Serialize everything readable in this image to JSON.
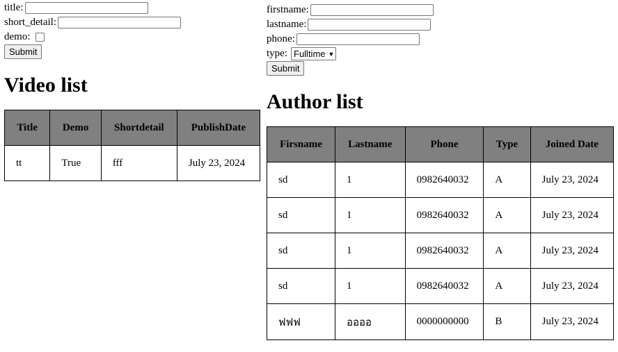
{
  "video_form": {
    "title_label": "title:",
    "short_detail_label": "short_detail:",
    "demo_label": "demo:",
    "submit_label": "Submit"
  },
  "video_list": {
    "heading": "Video list",
    "columns": [
      "Title",
      "Demo",
      "Shortdetail",
      "PublishDate"
    ],
    "rows": [
      [
        "tt",
        "True",
        "fff",
        "July 23, 2024"
      ]
    ]
  },
  "author_form": {
    "firstname_label": "firstname:",
    "lastname_label": "lastname:",
    "phone_label": "phone:",
    "type_label": "type:",
    "type_selected": "Fulltime",
    "submit_label": "Submit"
  },
  "author_list": {
    "heading": "Author list",
    "columns": [
      "Firsname",
      "Lastname",
      "Phone",
      "Type",
      "Joined Date"
    ],
    "rows": [
      [
        "sd",
        "1",
        "0982640032",
        "A",
        "July 23, 2024"
      ],
      [
        "sd",
        "1",
        "0982640032",
        "A",
        "July 23, 2024"
      ],
      [
        "sd",
        "1",
        "0982640032",
        "A",
        "July 23, 2024"
      ],
      [
        "sd",
        "1",
        "0982640032",
        "A",
        "July 23, 2024"
      ],
      [
        "ฟฟฟ",
        "ออออ",
        "0000000000",
        "B",
        "July 23, 2024"
      ]
    ]
  }
}
